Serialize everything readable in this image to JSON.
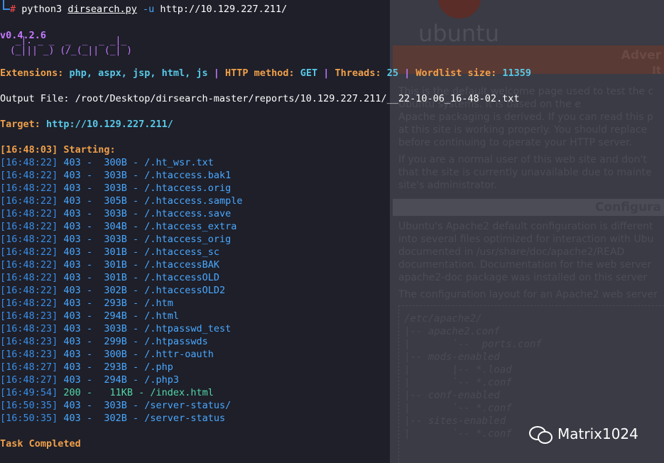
{
  "command": {
    "interpreter": "python3",
    "script": "dirsearch.py",
    "flag": "-u",
    "url": "http://10.129.227.211/"
  },
  "banner": {
    "version": "v0.4.2.6"
  },
  "config": {
    "ext_label": "Extensions:",
    "ext_value": "php, aspx, jsp, html, js",
    "method_label": "HTTP method:",
    "method_value": "GET",
    "threads_label": "Threads:",
    "threads_value": "25",
    "wordlist_label": "Wordlist size:",
    "wordlist_value": "11359",
    "sep": "|"
  },
  "output_file": {
    "label": "Output File:",
    "path": "/root/Desktop/dirsearch-master/reports/10.129.227.211/__22-10-06_16-48-02.txt"
  },
  "target": {
    "label": "Target:",
    "url": "http://10.129.227.211/"
  },
  "starting": {
    "time": "[16:48:03]",
    "label": "Starting:"
  },
  "results": [
    {
      "time": "[16:48:22]",
      "status": "403",
      "size": "300B",
      "path": "/.ht_wsr.txt"
    },
    {
      "time": "[16:48:22]",
      "status": "403",
      "size": "303B",
      "path": "/.htaccess.bak1"
    },
    {
      "time": "[16:48:22]",
      "status": "403",
      "size": "303B",
      "path": "/.htaccess.orig"
    },
    {
      "time": "[16:48:22]",
      "status": "403",
      "size": "305B",
      "path": "/.htaccess.sample"
    },
    {
      "time": "[16:48:22]",
      "status": "403",
      "size": "303B",
      "path": "/.htaccess.save"
    },
    {
      "time": "[16:48:22]",
      "status": "403",
      "size": "304B",
      "path": "/.htaccess_extra"
    },
    {
      "time": "[16:48:22]",
      "status": "403",
      "size": "303B",
      "path": "/.htaccess_orig"
    },
    {
      "time": "[16:48:22]",
      "status": "403",
      "size": "301B",
      "path": "/.htaccess_sc"
    },
    {
      "time": "[16:48:22]",
      "status": "403",
      "size": "301B",
      "path": "/.htaccessBAK"
    },
    {
      "time": "[16:48:22]",
      "status": "403",
      "size": "301B",
      "path": "/.htaccessOLD"
    },
    {
      "time": "[16:48:22]",
      "status": "403",
      "size": "302B",
      "path": "/.htaccessOLD2"
    },
    {
      "time": "[16:48:22]",
      "status": "403",
      "size": "293B",
      "path": "/.htm"
    },
    {
      "time": "[16:48:23]",
      "status": "403",
      "size": "294B",
      "path": "/.html"
    },
    {
      "time": "[16:48:23]",
      "status": "403",
      "size": "303B",
      "path": "/.htpasswd_test"
    },
    {
      "time": "[16:48:23]",
      "status": "403",
      "size": "299B",
      "path": "/.htpasswds"
    },
    {
      "time": "[16:48:23]",
      "status": "403",
      "size": "300B",
      "path": "/.httr-oauth"
    },
    {
      "time": "[16:48:27]",
      "status": "403",
      "size": "293B",
      "path": "/.php"
    },
    {
      "time": "[16:48:27]",
      "status": "403",
      "size": "294B",
      "path": "/.php3"
    },
    {
      "time": "[16:49:54]",
      "status": "200",
      "size": "11KB",
      "path": "/index.html",
      "ok": true
    },
    {
      "time": "[16:50:35]",
      "status": "403",
      "size": "303B",
      "path": "/server-status/"
    },
    {
      "time": "[16:50:35]",
      "status": "403",
      "size": "302B",
      "path": "/server-status"
    }
  ],
  "task": "Task Completed",
  "background_page": {
    "logo_text": "ubuntu",
    "bar_text": "Adver",
    "bar2_text": "It",
    "para1": "This is the default welcome page used to test the c\nUbuntu systems. It is based on the e\nApache packaging is derived. If you can read this p\nat this site is working properly. You should replace\nbefore continuing to operate your HTTP server.",
    "para2": "If you are a normal user of this web site and don't\nthat the site is currently unavailable due to mainte\nsite's administrator.",
    "cfg_bar": "Configura",
    "para3": "Ubuntu's Apache2 default configuration is different\ninto several files optimized for interaction with Ubu\ndocumented in /usr/share/doc/apache2/READ\ndocumentation. Documentation for the web server\napache2-doc package was installed on this server",
    "para4": "The configuration layout for an Apache2 web server",
    "code": "/etc/apache2/\n|-- apache2.conf\n|       `--  ports.conf\n|-- mods-enabled\n|       |-- *.load\n|       `-- *.conf\n|-- conf-enabled\n|       `-- *.conf\n|-- sites-enabled\n|       `-- *.conf"
  },
  "watermark": {
    "text": "Matrix1024",
    "icon": "wechat-icon"
  }
}
